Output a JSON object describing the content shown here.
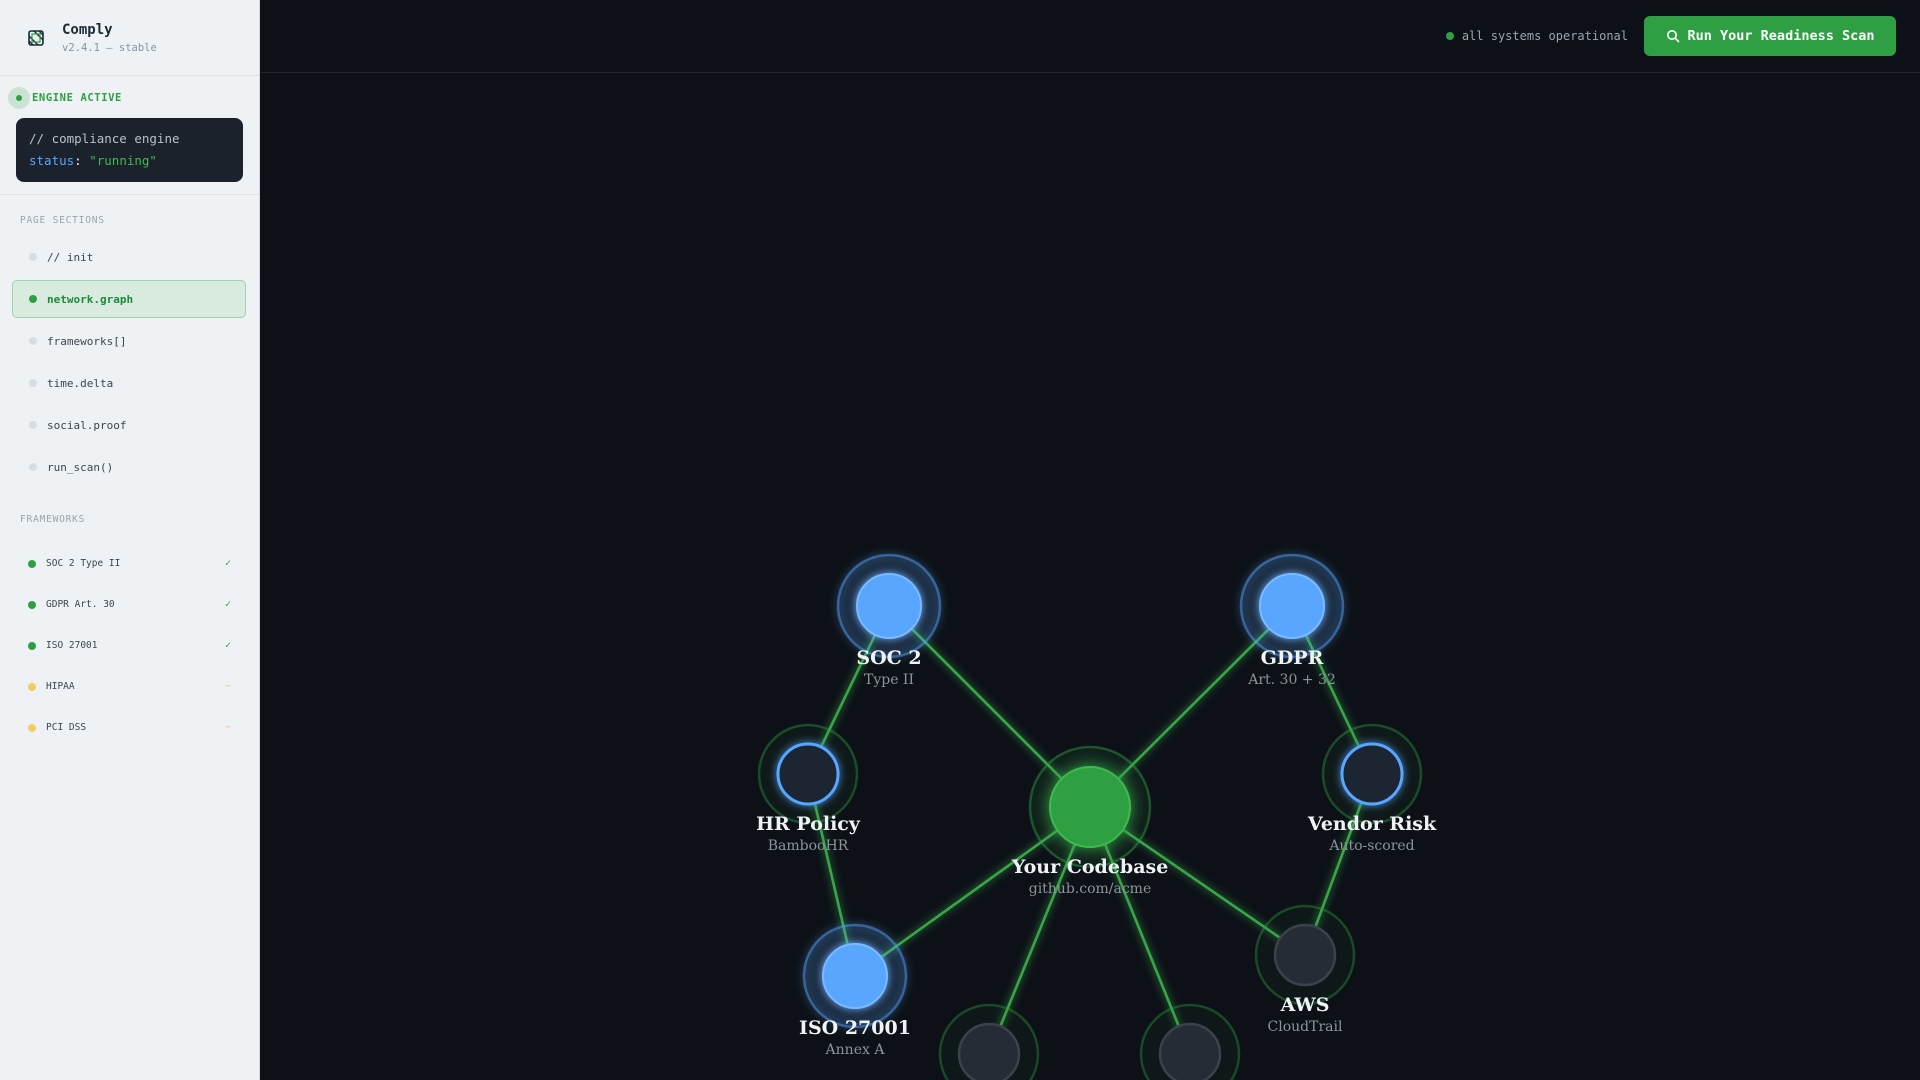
{
  "brand": {
    "name": "Comply",
    "version": "v2.4.1 — stable",
    "icon": "logo-icon"
  },
  "engine": {
    "status_label": "ENGINE ACTIVE",
    "code_comment": "// compliance engine",
    "code_key": "status",
    "code_value": "\"running\""
  },
  "nav": {
    "title": "PAGE SECTIONS",
    "items": [
      {
        "label": "// init",
        "active": false
      },
      {
        "label": "network.graph",
        "active": true
      },
      {
        "label": "frameworks[]",
        "active": false
      },
      {
        "label": "time.delta",
        "active": false
      },
      {
        "label": "social.proof",
        "active": false
      },
      {
        "label": "run_scan()",
        "active": false
      }
    ]
  },
  "frameworks": {
    "title": "FRAMEWORKS",
    "items": [
      {
        "label": "SOC 2 Type II",
        "mark": "✓",
        "status": "done"
      },
      {
        "label": "GDPR Art. 30",
        "mark": "✓",
        "status": "done"
      },
      {
        "label": "ISO 27001",
        "mark": "✓",
        "status": "done"
      },
      {
        "label": "HIPAA",
        "mark": "~",
        "status": "partial"
      },
      {
        "label": "PCI DSS",
        "mark": "~",
        "status": "partial"
      }
    ]
  },
  "topbar": {
    "status_text": "all systems operational",
    "scan_button": "Run Your Readiness Scan"
  },
  "colors": {
    "accent": "#2ea043",
    "framework_node": "#58a6ff",
    "source_node": "#1e2530",
    "partial": "#f2cc60",
    "edge": "#3fb950"
  },
  "graph": {
    "nodes": [
      {
        "id": "codebase",
        "kind": "center",
        "title": "Your Codebase",
        "sub": "github.com/acme"
      },
      {
        "id": "soc2",
        "kind": "framework",
        "title": "SOC 2",
        "sub": "Type II"
      },
      {
        "id": "gdpr",
        "kind": "framework",
        "title": "GDPR",
        "sub": "Art. 30 + 32"
      },
      {
        "id": "hr",
        "kind": "source",
        "title": "HR Policy",
        "sub": "BambooHR"
      },
      {
        "id": "vendor",
        "kind": "source",
        "title": "Vendor Risk",
        "sub": "Auto-scored"
      },
      {
        "id": "iso",
        "kind": "framework",
        "title": "ISO 27001",
        "sub": "Annex A"
      },
      {
        "id": "aws",
        "kind": "source-dim",
        "title": "AWS",
        "sub": "CloudTrail"
      },
      {
        "id": "bl",
        "kind": "source-dim",
        "title": "",
        "sub": ""
      },
      {
        "id": "br",
        "kind": "source-dim",
        "title": "",
        "sub": ""
      }
    ],
    "edges": [
      [
        "codebase",
        "soc2"
      ],
      [
        "codebase",
        "gdpr"
      ],
      [
        "codebase",
        "iso"
      ],
      [
        "codebase",
        "aws"
      ],
      [
        "codebase",
        "bl"
      ],
      [
        "codebase",
        "br"
      ],
      [
        "soc2",
        "hr"
      ],
      [
        "hr",
        "iso"
      ],
      [
        "gdpr",
        "vendor"
      ],
      [
        "vendor",
        "aws"
      ]
    ]
  }
}
